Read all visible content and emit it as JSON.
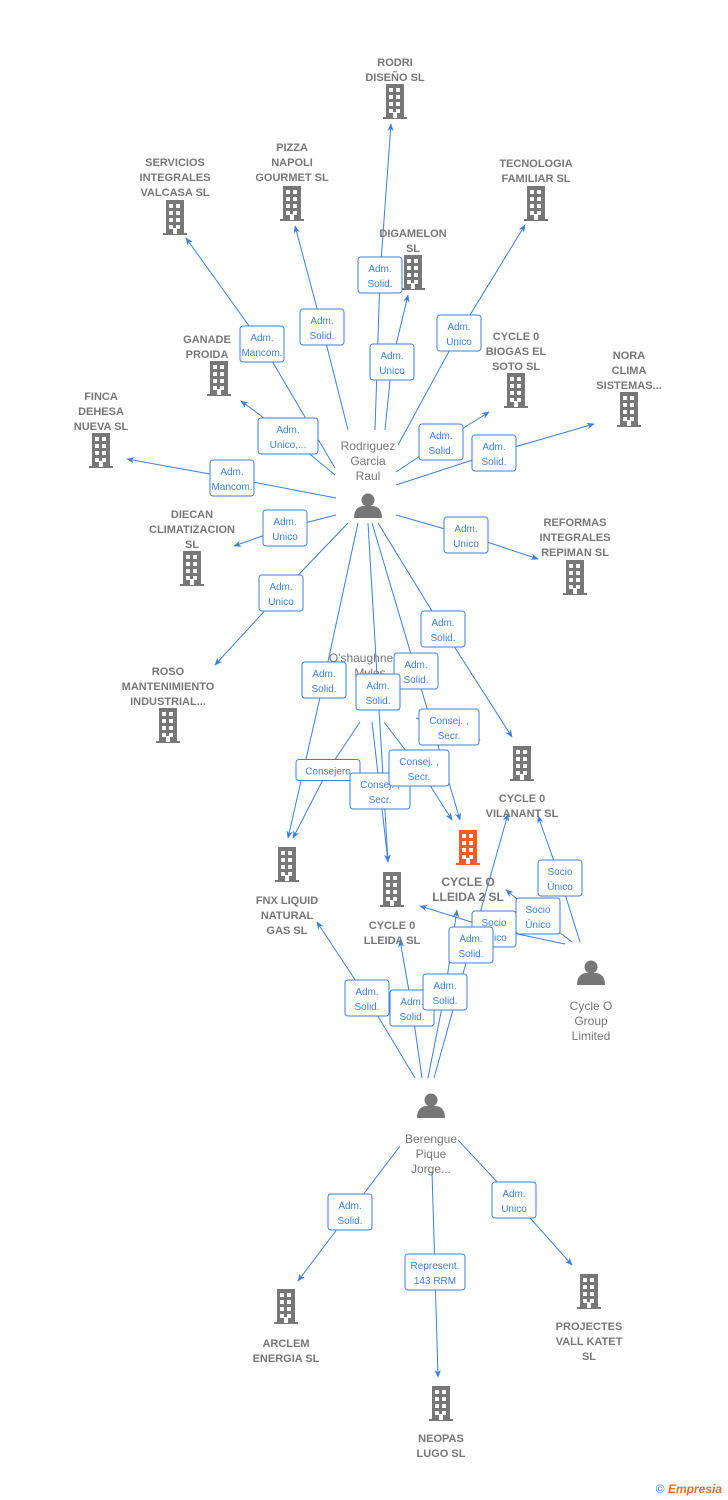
{
  "colors": {
    "edge": "#3d7fdc",
    "node": "#777777",
    "highlight": "#ff5a27"
  },
  "nodes": [
    {
      "id": "rodri",
      "type": "company",
      "lines": [
        "RODRI",
        "DISEÑO  SL"
      ]
    },
    {
      "id": "pizza",
      "type": "company",
      "lines": [
        "PIZZA",
        "NAPOLI",
        "GOURMET SL"
      ]
    },
    {
      "id": "servicios",
      "type": "company",
      "lines": [
        "SERVICIOS",
        "INTEGRALES",
        "VALCASA SL"
      ]
    },
    {
      "id": "tecnologia",
      "type": "company",
      "lines": [
        "TECNOLOGIA",
        "FAMILIAR  SL"
      ]
    },
    {
      "id": "digamelon",
      "type": "company",
      "lines": [
        "DIGAMELON",
        "SL"
      ]
    },
    {
      "id": "ganade",
      "type": "company",
      "lines": [
        "GANADE",
        "PROIDA"
      ]
    },
    {
      "id": "biogas",
      "type": "company",
      "lines": [
        "CYCLE 0",
        "BIOGAS EL",
        "SOTO  SL"
      ]
    },
    {
      "id": "nora",
      "type": "company",
      "lines": [
        "NORA",
        "CLIMA",
        "SISTEMAS..."
      ]
    },
    {
      "id": "finca",
      "type": "company",
      "lines": [
        "FINCA",
        "DEHESA",
        "NUEVA SL"
      ]
    },
    {
      "id": "rodriguez",
      "type": "person",
      "lines": [
        "Rodriguez",
        "Garcia",
        "Raul"
      ]
    },
    {
      "id": "diecan",
      "type": "company",
      "lines": [
        "DIECAN",
        "CLIMATIZACION",
        "SL"
      ]
    },
    {
      "id": "reformas",
      "type": "company",
      "lines": [
        "REFORMAS",
        "INTEGRALES",
        "REPIMAN  SL"
      ]
    },
    {
      "id": "roso",
      "type": "company",
      "lines": [
        "ROSO",
        "MANTENIMIENTO",
        "INDUSTRIAL..."
      ]
    },
    {
      "id": "oshaughnessy",
      "type": "person",
      "lines": [
        "O'shaughnessy",
        "Myles"
      ]
    },
    {
      "id": "vilanant",
      "type": "company",
      "lines": [
        "CYCLE 0",
        "VILANANT  SL"
      ]
    },
    {
      "id": "fnx",
      "type": "company",
      "lines": [
        "FNX LIQUID",
        "NATURAL",
        "GAS  SL"
      ]
    },
    {
      "id": "lleida2",
      "type": "company",
      "highlight": true,
      "lines": [
        "CYCLE O",
        "LLEIDA 2  SL"
      ]
    },
    {
      "id": "lleida",
      "type": "company",
      "lines": [
        "CYCLE 0",
        "LLEIDA  SL"
      ]
    },
    {
      "id": "cyclegroup",
      "type": "person",
      "lines": [
        "Cycle O",
        "Group",
        "Limited"
      ]
    },
    {
      "id": "berengue",
      "type": "person",
      "lines": [
        "Berengue",
        "Pique",
        "Jorge..."
      ]
    },
    {
      "id": "arclem",
      "type": "company",
      "lines": [
        "ARCLEM",
        "ENERGIA  SL"
      ]
    },
    {
      "id": "neopas",
      "type": "company",
      "lines": [
        "NEOPAS",
        "LUGO SL"
      ]
    },
    {
      "id": "projectes",
      "type": "company",
      "lines": [
        "PROJECTES",
        "VALL KATET",
        "SL"
      ]
    }
  ],
  "edges": [
    {
      "from": "rodriguez",
      "to": "rodri",
      "lines": [
        "Adm.",
        "Solid."
      ]
    },
    {
      "from": "rodriguez",
      "to": "pizza",
      "lines": [
        "Adm.",
        "Solid."
      ]
    },
    {
      "from": "rodriguez",
      "to": "servicios",
      "lines": [
        "Adm.",
        "Mancom."
      ]
    },
    {
      "from": "rodriguez",
      "to": "digamelon",
      "lines": [
        "Adm.",
        "Unico"
      ]
    },
    {
      "from": "rodriguez",
      "to": "tecnologia",
      "lines": [
        "Adm.",
        "Unico"
      ]
    },
    {
      "from": "rodriguez",
      "to": "ganade",
      "lines": [
        "Adm.",
        "Unico,..."
      ]
    },
    {
      "from": "rodriguez",
      "to": "biogas",
      "lines": [
        "Adm.",
        "Solid."
      ]
    },
    {
      "from": "rodriguez",
      "to": "nora",
      "lines": [
        "Adm.",
        "Solid."
      ]
    },
    {
      "from": "rodriguez",
      "to": "finca",
      "lines": [
        "Adm.",
        "Mancom."
      ]
    },
    {
      "from": "rodriguez",
      "to": "diecan",
      "lines": [
        "Adm.",
        "Unico"
      ]
    },
    {
      "from": "rodriguez",
      "to": "reformas",
      "lines": [
        "Adm.",
        "Unico"
      ]
    },
    {
      "from": "rodriguez",
      "to": "roso",
      "lines": [
        "Adm.",
        "Unico"
      ]
    },
    {
      "from": "rodriguez",
      "to": "vilanant",
      "lines": [
        "Adm.",
        "Solid."
      ]
    },
    {
      "from": "rodriguez",
      "to": "fnx",
      "lines": [
        "Adm.",
        "Solid."
      ]
    },
    {
      "from": "rodriguez",
      "to": "lleida2",
      "lines": [
        "Adm.",
        "Solid."
      ]
    },
    {
      "from": "rodriguez",
      "to": "lleida",
      "lines": [
        "Adm.",
        "Solid."
      ]
    },
    {
      "from": "oshaughnessy",
      "to": "lleida2",
      "lines": [
        "Consej. ,",
        "Secr."
      ]
    },
    {
      "from": "oshaughnessy",
      "to": "fnx",
      "lines": [
        "Consejero"
      ]
    },
    {
      "from": "oshaughnessy",
      "to": "lleida",
      "lines": [
        "Consej. ,",
        "Secr."
      ]
    },
    {
      "from": "oshaughnessy",
      "to": "lleida2",
      "lines": [
        "Consej. ,",
        "Secr."
      ]
    },
    {
      "from": "cyclegroup",
      "to": "vilanant",
      "lines": [
        "Socio",
        "Único"
      ]
    },
    {
      "from": "cyclegroup",
      "to": "lleida2",
      "lines": [
        "Socio",
        "Único"
      ]
    },
    {
      "from": "cyclegroup",
      "to": "lleida",
      "lines": [
        "Socio",
        "Único"
      ]
    },
    {
      "from": "berengue",
      "to": "fnx",
      "lines": [
        "Adm.",
        "Solid."
      ]
    },
    {
      "from": "berengue",
      "to": "lleida",
      "lines": [
        "Adm.",
        "Solid."
      ]
    },
    {
      "from": "berengue",
      "to": "lleida2",
      "lines": [
        "Adm.",
        "Solid."
      ]
    },
    {
      "from": "berengue",
      "to": "vilanant",
      "lines": [
        "Adm.",
        "Solid."
      ]
    },
    {
      "from": "berengue",
      "to": "arclem",
      "lines": [
        "Adm.",
        "Solid."
      ]
    },
    {
      "from": "berengue",
      "to": "neopas",
      "lines": [
        "Represent.",
        "143 RRM"
      ]
    },
    {
      "from": "berengue",
      "to": "projectes",
      "lines": [
        "Adm.",
        "Unico"
      ]
    }
  ],
  "footer": {
    "copyright": "©",
    "brand": "Empresia"
  }
}
